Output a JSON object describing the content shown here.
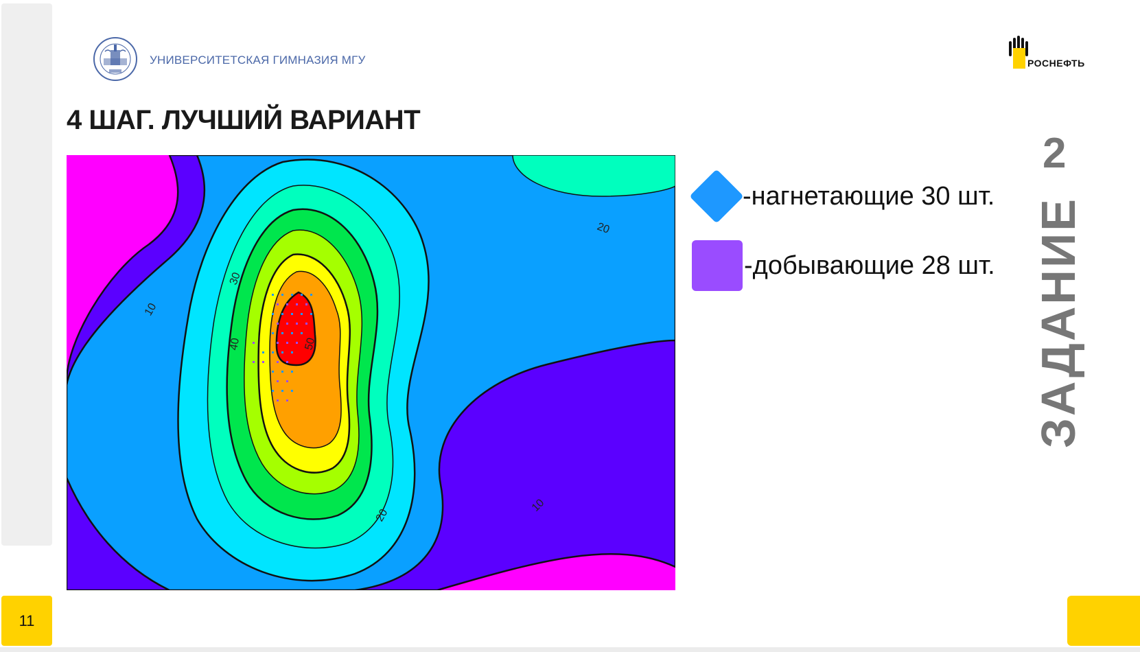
{
  "header": {
    "school_name": "УНИВЕРСИТЕТСКАЯ ГИМНАЗИЯ МГУ",
    "school_logo_text": "УНИВЕРСИТЕТСКАЯ ГИМНАЗИЯ МГУ",
    "partner_name": "РОСНЕФТЬ"
  },
  "slide": {
    "title": "4 ШАГ. ЛУЧШИЙ ВАРИАНТ",
    "page_number": "11",
    "task_number": "2",
    "task_label": "ЗАДАНИЕ"
  },
  "map": {
    "contour_labels": [
      "10",
      "20",
      "30",
      "40",
      "50",
      "20",
      "10"
    ]
  },
  "legend": {
    "injection": {
      "label": "-нагнетающие 30 шт.",
      "count": 30,
      "color": "#1e98ff",
      "icon": "diamond-icon"
    },
    "production": {
      "label": "-добывающие 28 шт.",
      "count": 28,
      "color": "#9a4cff",
      "icon": "square-icon"
    }
  },
  "colors": {
    "accent_yellow": "#ffd200",
    "school_blue": "#4b68a8",
    "task_gray": "#777777"
  }
}
